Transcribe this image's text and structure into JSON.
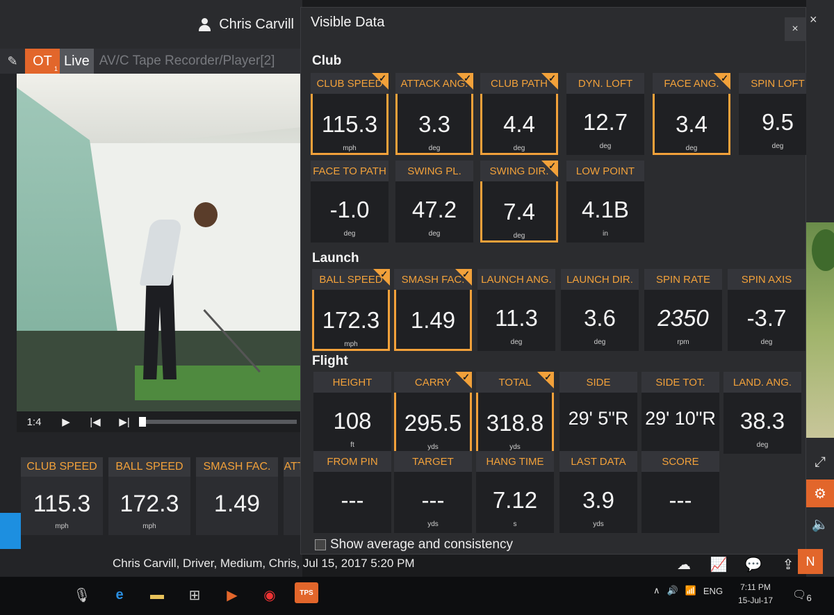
{
  "user": {
    "name": "Chris Carvill"
  },
  "tabs": {
    "ot": "OT",
    "ot_badge": "1",
    "live": "Live",
    "recorder": "AV/C Tape Recorder/Player[2]"
  },
  "player": {
    "time": "1:4"
  },
  "bottom_tiles": [
    {
      "label": "CLUB SPEED",
      "value": "115.3",
      "unit": "mph"
    },
    {
      "label": "BALL SPEED",
      "value": "172.3",
      "unit": "mph"
    },
    {
      "label": "SMASH FAC.",
      "value": "1.49",
      "unit": ""
    },
    {
      "label": "ATT",
      "value": "",
      "unit": ""
    }
  ],
  "session": "Chris Carvill, Driver, Medium, Chris, Jul 15, 2017 5:20 PM",
  "dialog": {
    "title": "Visible Data",
    "close": "×",
    "show_average_label": "Show average and consistency",
    "sections": {
      "club": "Club",
      "launch": "Launch",
      "flight": "Flight"
    },
    "club": [
      {
        "label": "CLUB SPEED",
        "value": "115.3",
        "unit": "mph",
        "selected": true
      },
      {
        "label": "ATTACK ANG.",
        "value": "3.3",
        "unit": "deg",
        "selected": true
      },
      {
        "label": "CLUB PATH",
        "value": "4.4",
        "unit": "deg",
        "selected": true
      },
      {
        "label": "DYN. LOFT",
        "value": "12.7",
        "unit": "deg",
        "selected": false
      },
      {
        "label": "FACE ANG.",
        "value": "3.4",
        "unit": "deg",
        "selected": true
      },
      {
        "label": "SPIN LOFT",
        "value": "9.5",
        "unit": "deg",
        "selected": false
      },
      {
        "label": "FACE TO PATH",
        "value": "-1.0",
        "unit": "deg",
        "selected": false
      },
      {
        "label": "SWING PL.",
        "value": "47.2",
        "unit": "deg",
        "selected": false
      },
      {
        "label": "SWING DIR.",
        "value": "7.4",
        "unit": "deg",
        "selected": true
      },
      {
        "label": "LOW POINT",
        "value": "4.1B",
        "unit": "in",
        "selected": false
      }
    ],
    "launch": [
      {
        "label": "BALL SPEED",
        "value": "172.3",
        "unit": "mph",
        "selected": true
      },
      {
        "label": "SMASH FAC.",
        "value": "1.49",
        "unit": "",
        "selected": true
      },
      {
        "label": "LAUNCH ANG.",
        "value": "11.3",
        "unit": "deg",
        "selected": false
      },
      {
        "label": "LAUNCH DIR.",
        "value": "3.6",
        "unit": "deg",
        "selected": false
      },
      {
        "label": "SPIN RATE",
        "value": "2350",
        "unit": "rpm",
        "selected": false
      },
      {
        "label": "SPIN AXIS",
        "value": "-3.7",
        "unit": "deg",
        "selected": false
      }
    ],
    "flight": [
      {
        "label": "HEIGHT",
        "value": "108",
        "unit": "ft",
        "selected": false
      },
      {
        "label": "CARRY",
        "value": "295.5",
        "unit": "yds",
        "selected": true
      },
      {
        "label": "TOTAL",
        "value": "318.8",
        "unit": "yds",
        "selected": true
      },
      {
        "label": "SIDE",
        "value": "29' 5\"R",
        "unit": "",
        "selected": false
      },
      {
        "label": "SIDE TOT.",
        "value": "29' 10\"R",
        "unit": "",
        "selected": false
      },
      {
        "label": "LAND. ANG.",
        "value": "38.3",
        "unit": "deg",
        "selected": false
      },
      {
        "label": "FROM PIN",
        "value": "---",
        "unit": "",
        "selected": false
      },
      {
        "label": "TARGET",
        "value": "---",
        "unit": "yds",
        "selected": false
      },
      {
        "label": "HANG TIME",
        "value": "7.12",
        "unit": "s",
        "selected": false
      },
      {
        "label": "LAST DATA",
        "value": "3.9",
        "unit": "yds",
        "selected": false
      },
      {
        "label": "SCORE",
        "value": "---",
        "unit": "",
        "selected": false
      }
    ]
  },
  "sidebar": {
    "n_label": "N"
  },
  "taskbar": {
    "tps_label": "TPS",
    "lang": "ENG",
    "time": "7:11 PM",
    "date": "15-Jul-17",
    "notify_count": "6"
  },
  "colors": {
    "accent": "#e2662b",
    "highlight": "#f2a13a",
    "panel": "#2b2c2f"
  },
  "icons": [
    "user-icon",
    "pencil-icon",
    "play-icon",
    "step-back-icon",
    "step-forward-icon",
    "close-icon",
    "expand-icon",
    "gear-icon",
    "speaker-icon",
    "cloud-upload-icon",
    "chart-icon",
    "comment-icon",
    "export-icon"
  ]
}
